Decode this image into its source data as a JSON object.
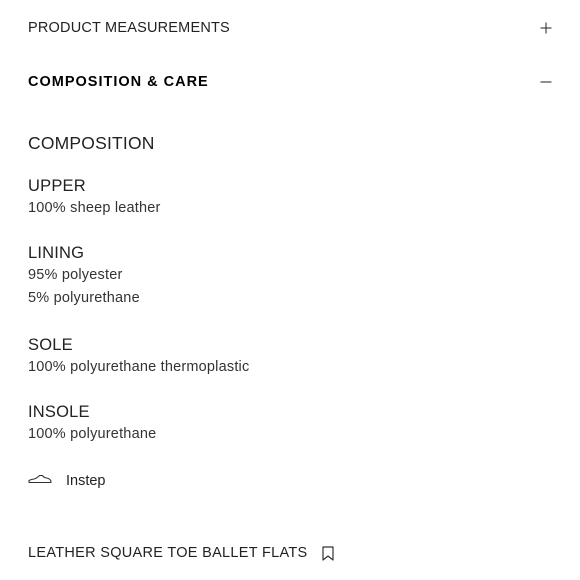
{
  "accordion": {
    "measurements_label": "PRODUCT MEASUREMENTS",
    "composition_label": "COMPOSITION & CARE"
  },
  "composition": {
    "heading": "COMPOSITION",
    "parts": [
      {
        "label": "UPPER",
        "lines": [
          "100% sheep leather"
        ]
      },
      {
        "label": "LINING",
        "lines": [
          "95% polyester",
          "5% polyurethane"
        ]
      },
      {
        "label": "SOLE",
        "lines": [
          "100% polyurethane thermoplastic"
        ]
      },
      {
        "label": "INSOLE",
        "lines": [
          "100% polyurethane"
        ]
      }
    ]
  },
  "care": {
    "icon": "shoe-icon",
    "label": "Instep"
  },
  "product": {
    "name": "LEATHER SQUARE TOE BALLET FLATS",
    "bookmark_icon": "bookmark-icon"
  }
}
